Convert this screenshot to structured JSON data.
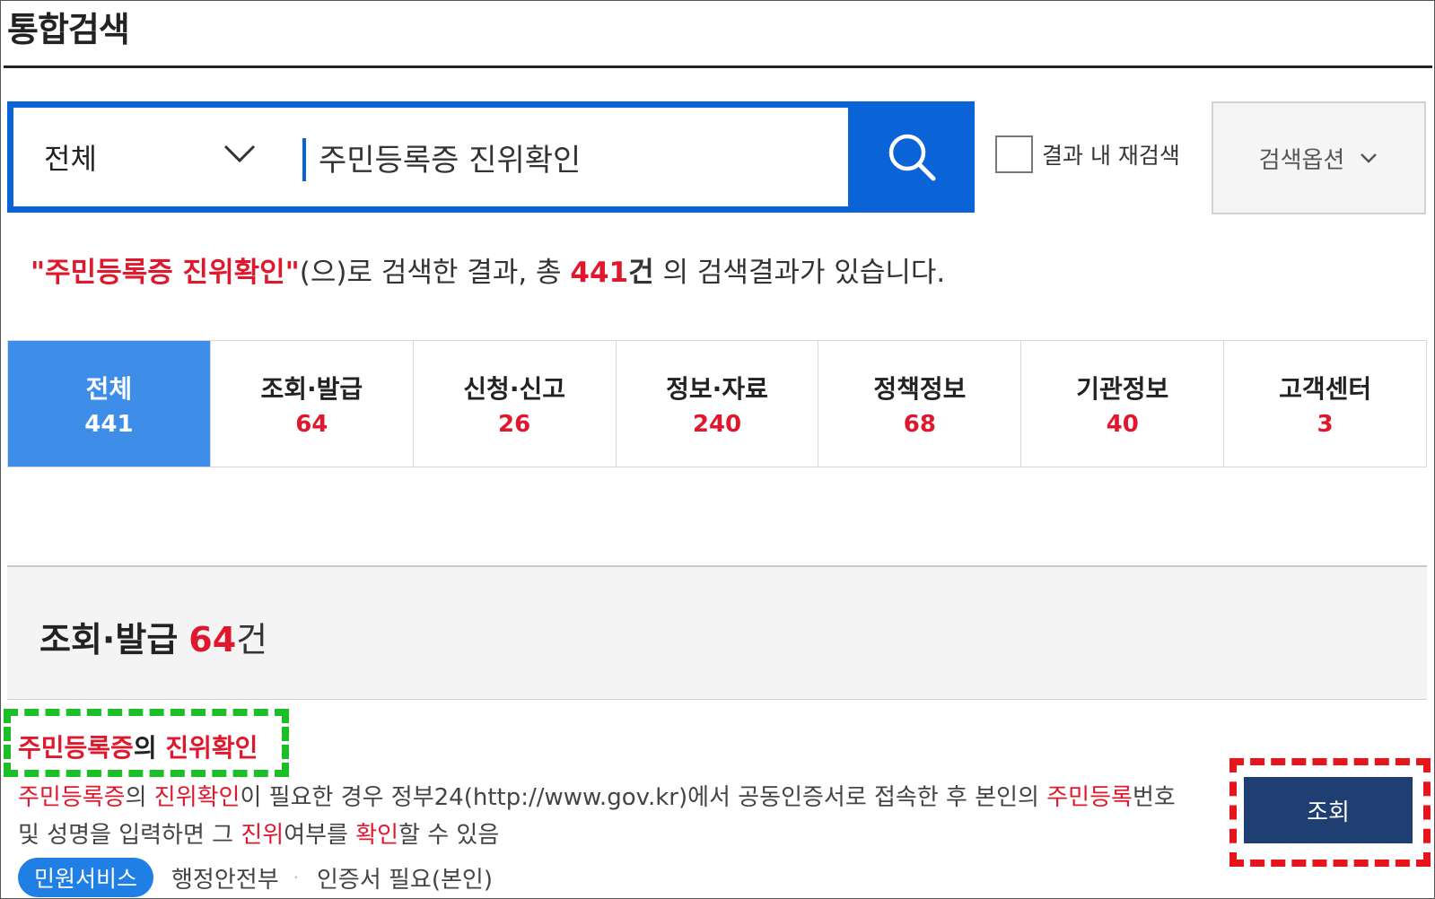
{
  "page": {
    "title": "통합검색"
  },
  "search": {
    "scope": "전체",
    "query": "주민등록증 진위확인",
    "refine_label": "결과 내 재검색",
    "options_label": "검색옵션"
  },
  "summary": {
    "quote_open": "\"",
    "query": "주민등록증 진위확인",
    "quote_close": "\"",
    "text1": "(으)로 검색한 결과, 총 ",
    "count": "441",
    "unit": "건",
    "text2": " 의 검색결과가 있습니다."
  },
  "tabs": [
    {
      "label": "전체",
      "count": "441",
      "active": true
    },
    {
      "label": "조회·발급",
      "count": "64"
    },
    {
      "label": "신청·신고",
      "count": "26"
    },
    {
      "label": "정보·자료",
      "count": "240"
    },
    {
      "label": "정책정보",
      "count": "68"
    },
    {
      "label": "기관정보",
      "count": "40"
    },
    {
      "label": "고객센터",
      "count": "3"
    }
  ],
  "section": {
    "title": "조회·발급",
    "count": "64",
    "unit": "건"
  },
  "result": {
    "title_parts": [
      "주민등록증",
      "의 ",
      "진위확인"
    ],
    "desc_parts": [
      "주민등록증",
      "의 ",
      "진위확인",
      "이 필요한 경우 정부24(http://www.gov.kr)에서 공동인증서로 접속한 후 본인의 ",
      "주민등록",
      "번호 및 성명을 입력하면 그 ",
      "진위",
      "여부를 ",
      "확인",
      "할 수 있음"
    ],
    "badge": "민원서비스",
    "agency": "행정안전부",
    "separator": "·",
    "requirement": "인증서 필요(본인)",
    "action_label": "조회"
  },
  "colors": {
    "accent_blue": "#0a64d8",
    "active_tab": "#3e8de8",
    "highlight_red": "#e0182d",
    "button_navy": "#1f3f73",
    "annotation_green": "#1dbf28",
    "annotation_red": "#e8141c"
  },
  "icons": {
    "scope_dropdown": "chevron-down-icon",
    "search": "search-icon",
    "options": "chevron-down-icon"
  }
}
